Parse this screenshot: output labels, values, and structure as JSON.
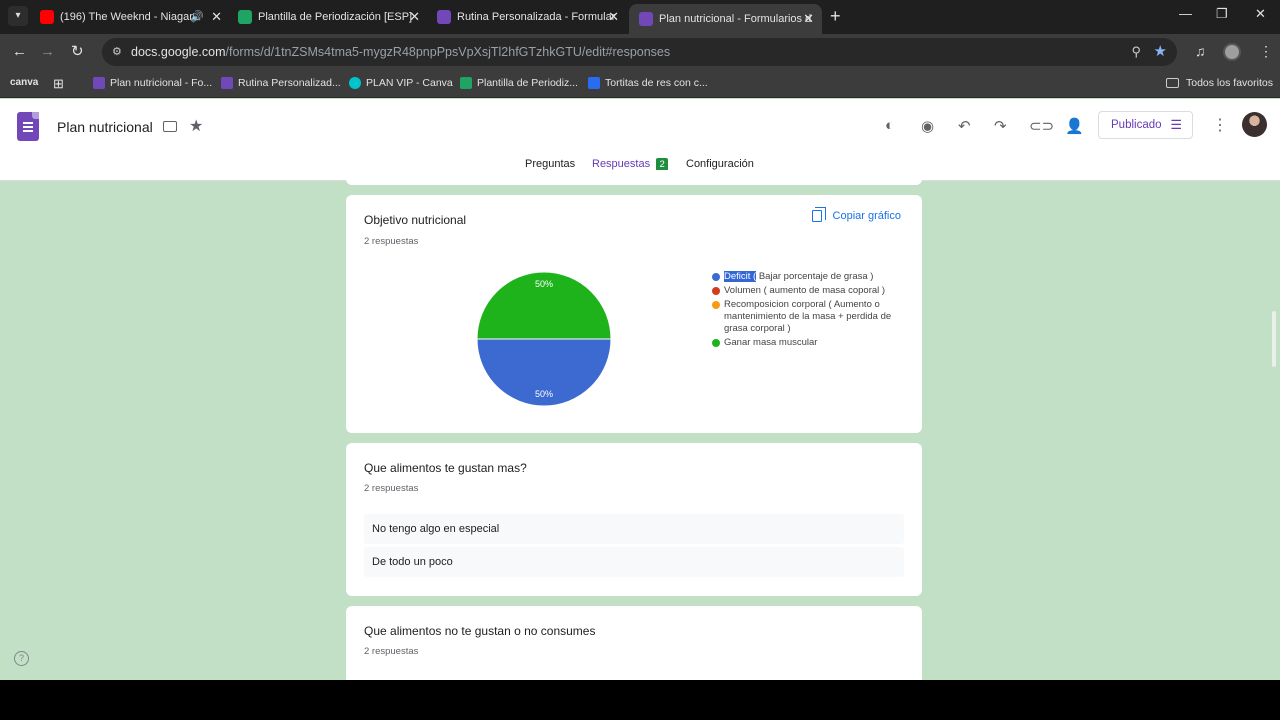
{
  "browser": {
    "tabs": [
      {
        "title": "(196) The Weeknd - Niagara",
        "favicon": "youtube-icon"
      },
      {
        "title": "Plantilla de Periodización [ESP]",
        "favicon": "sheets-icon"
      },
      {
        "title": "Rutina Personalizada - Formular",
        "favicon": "forms-icon"
      },
      {
        "title": "Plan nutricional - Formularios d",
        "favicon": "forms-icon"
      }
    ],
    "url_host": "docs.google.com",
    "url_path": "/forms/d/1tnZSMs4tma5-mygzR48pnpPpsVpXsjTl2hfGTzhkGTU/edit#responses",
    "bookmarks": [
      {
        "label": "canva"
      },
      {
        "label": "Plan nutricional - Fo..."
      },
      {
        "label": "Rutina Personalizad..."
      },
      {
        "label": "PLAN VIP - Canva"
      },
      {
        "label": "Plantilla de Periodiz..."
      },
      {
        "label": "Tortitas de res con c..."
      }
    ],
    "all_bookmarks": "Todos los favoritos"
  },
  "forms": {
    "title": "Plan nutricional",
    "publish_label": "Publicado",
    "tabs": {
      "questions": "Preguntas",
      "responses": "Respuestas",
      "responses_count": "2",
      "settings": "Configuración"
    }
  },
  "cards": {
    "objective": {
      "title": "Objetivo nutricional",
      "count": "2 respuestas",
      "copy_label": "Copiar gráfico"
    },
    "likes": {
      "title": "Que alimentos te gustan mas?",
      "count": "2 respuestas",
      "responses": [
        "No tengo algo en especial",
        "De todo un poco"
      ]
    },
    "dislikes": {
      "title": "Que alimentos no te gustan o no consumes",
      "count": "2 respuestas"
    }
  },
  "chart_data": {
    "type": "pie",
    "series": [
      {
        "name": "Ganar masa muscular",
        "value": 50,
        "color": "#1fb31b",
        "label": "50%"
      },
      {
        "name": "Bajar porcentaje de grasa )",
        "value": 50,
        "color": "#3c6ad1",
        "label": "50%"
      }
    ],
    "legend": [
      {
        "highlight": "Deficit (",
        "text": " Bajar porcentaje de grasa )",
        "color": "#3c6ad1"
      },
      {
        "highlight": "",
        "text": "Volumen ( aumento de masa coporal )",
        "color": "#d43a1c"
      },
      {
        "highlight": "",
        "text": "Recomposicion corporal ( Aumento o mantenimiento de la masa + perdida de grasa corporal )",
        "color": "#f59b14"
      },
      {
        "highlight": "",
        "text": "Ganar masa muscular",
        "color": "#1fb31b"
      }
    ],
    "legend_position": "right"
  }
}
